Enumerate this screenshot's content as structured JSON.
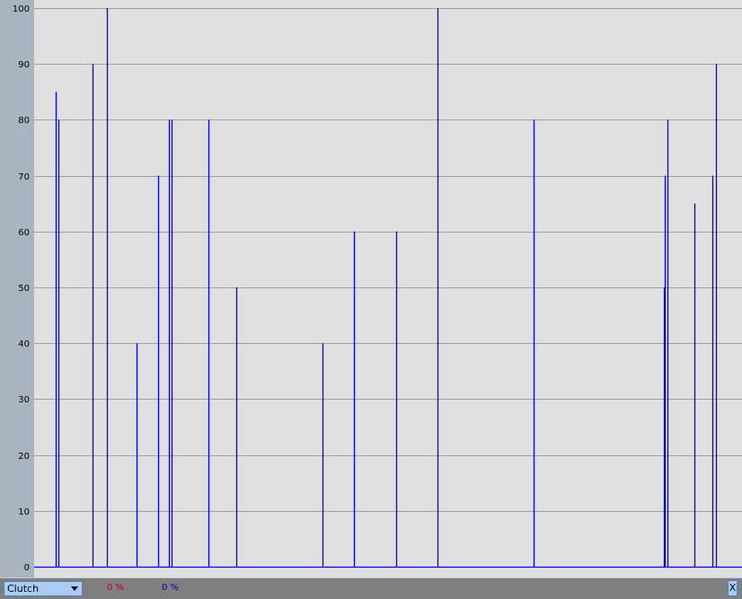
{
  "chart_data": {
    "type": "line",
    "ylim": [
      0,
      100
    ],
    "yticks": [
      "0",
      "10",
      "20",
      "30",
      "40",
      "50",
      "60",
      "70",
      "80",
      "90",
      "100"
    ],
    "grid": true,
    "series_color": "#0000ff",
    "background": "#e0e0e0",
    "spikes": [
      {
        "x": 62,
        "y": 85
      },
      {
        "x": 65,
        "y": 80
      },
      {
        "x": 103,
        "y": 90
      },
      {
        "x": 119,
        "y": 100
      },
      {
        "x": 152,
        "y": 40
      },
      {
        "x": 176,
        "y": 70
      },
      {
        "x": 188,
        "y": 80
      },
      {
        "x": 191,
        "y": 80
      },
      {
        "x": 232,
        "y": 80
      },
      {
        "x": 263,
        "y": 50
      },
      {
        "x": 359,
        "y": 40
      },
      {
        "x": 394,
        "y": 60
      },
      {
        "x": 441,
        "y": 60
      },
      {
        "x": 487,
        "y": 100
      },
      {
        "x": 594,
        "y": 80
      },
      {
        "x": 739,
        "y": 50
      },
      {
        "x": 740,
        "y": 70
      },
      {
        "x": 743,
        "y": 80
      },
      {
        "x": 773,
        "y": 65
      },
      {
        "x": 793,
        "y": 70
      },
      {
        "x": 797,
        "y": 90
      }
    ]
  },
  "toolbar": {
    "channel_value": "Clutch",
    "red_percent": "0 %",
    "blue_percent": "0 %",
    "close_label": "X"
  },
  "icons": {
    "dropdown": "chevron-down-icon"
  }
}
